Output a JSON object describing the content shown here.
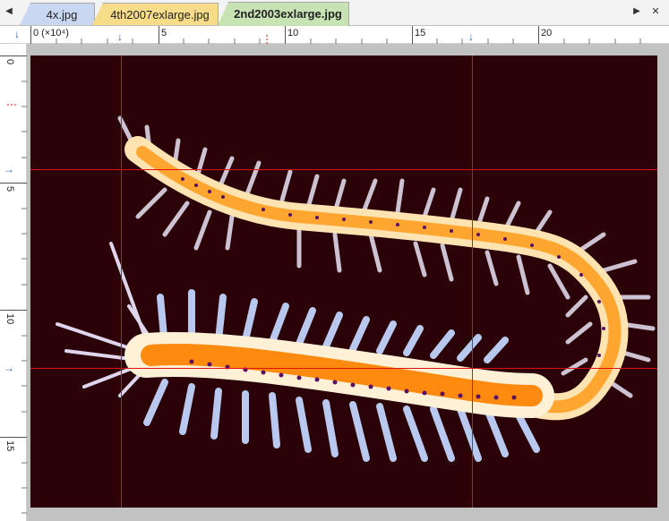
{
  "tabs": [
    {
      "label": "4x.jpg",
      "color": "#c9d7f3"
    },
    {
      "label": "4th2007exlarge.jpg",
      "color": "#f7dd8a"
    },
    {
      "label": "2nd2003exlarge.jpg",
      "color": "#c7e3b4",
      "active": true
    }
  ],
  "tab_nav": {
    "left": "◀",
    "right": "▶",
    "close": "✕"
  },
  "ruler_top": {
    "labels": [
      "0 (×10⁴)",
      "5",
      "10",
      "15",
      "20"
    ]
  },
  "ruler_left": {
    "labels": [
      "0",
      "5",
      "10",
      "15"
    ]
  },
  "image": {
    "background": "#2a0208",
    "subject": "segmented marine worm",
    "guide_color": "#e01010"
  }
}
